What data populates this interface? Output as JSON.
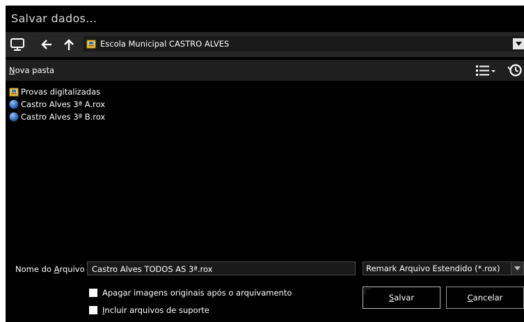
{
  "page_fragment": "",
  "title": "Salvar dados...",
  "nav": {
    "path": "Escola Municipal CASTRO ALVES"
  },
  "toolbar": {
    "new_folder_hotkey": "N",
    "new_folder_rest": "ova pasta"
  },
  "files": [
    {
      "name": "Provas digitalizadas",
      "icon": "folder-icon"
    },
    {
      "name": "Castro Alves 3ª A.rox",
      "icon": "sphere-file-icon"
    },
    {
      "name": "Castro Alves 3ª B.rox",
      "icon": "sphere-file-icon"
    }
  ],
  "bottom": {
    "filename_label_a": "Nome do ",
    "filename_label_hotkey": "A",
    "filename_label_b": "rquivo",
    "filename_value": "Castro Alves TODOS AS 3ª.rox",
    "filetype_value": "Remark Arquivo Estendido (*.rox)",
    "check1": "Apagar imagens originais após o arquivamento",
    "check2_hotkey": "I",
    "check2_rest": "ncluir arquivos de suporte",
    "save_hotkey": "S",
    "save_rest": "alvar",
    "cancel_hotkey": "C",
    "cancel_rest": "ancelar"
  },
  "colors": {
    "window_bg": "#000000",
    "navbar_bg": "#262626",
    "folder_icon": "#f2c94c",
    "sphere_icon": "#2f74d0"
  }
}
